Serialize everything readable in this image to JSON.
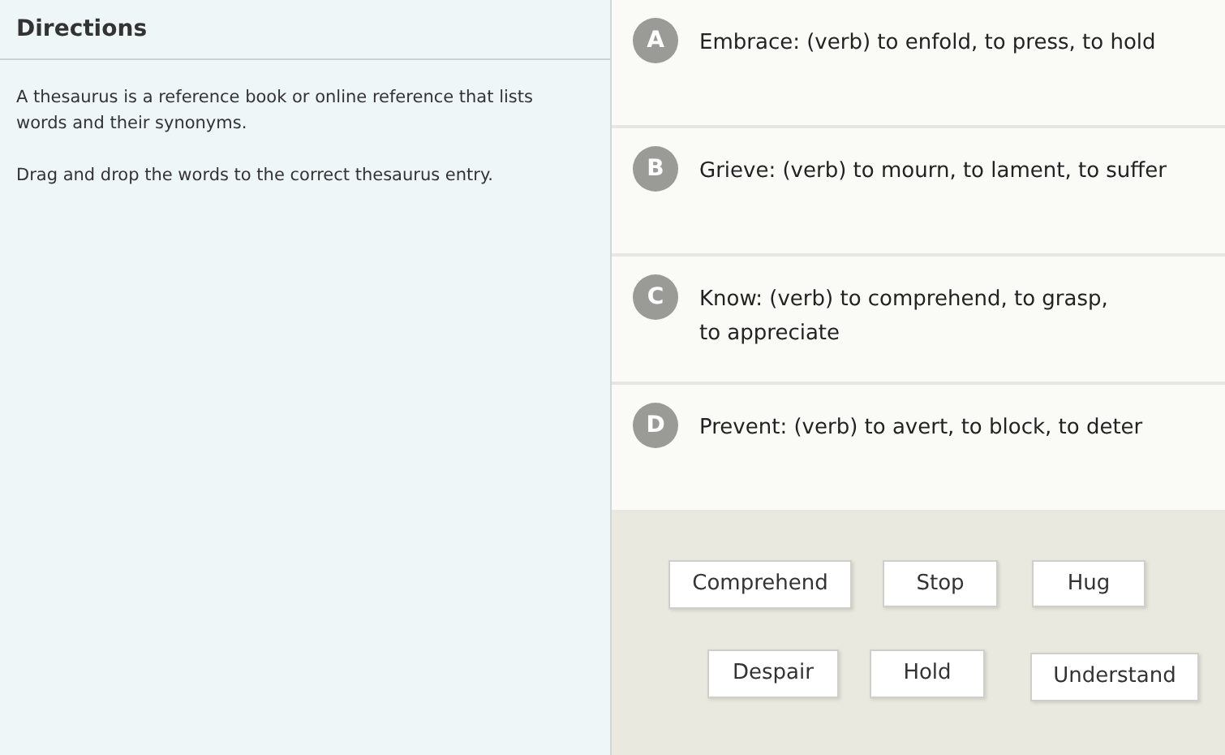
{
  "directions": {
    "title": "Directions",
    "paragraphs": [
      "A thesaurus is a reference book or online reference that lists words and their synonyms.",
      "Drag and drop the words to the correct thesaurus entry."
    ]
  },
  "entries": [
    {
      "letter": "A",
      "lines": [
        "Embrace: (verb) to enfold, to press, to hold"
      ]
    },
    {
      "letter": "B",
      "lines": [
        "Grieve: (verb) to mourn, to lament, to suffer"
      ]
    },
    {
      "letter": "C",
      "lines": [
        "Know: (verb) to comprehend, to grasp,",
        "to appreciate"
      ]
    },
    {
      "letter": "D",
      "lines": [
        "Prevent: (verb) to avert, to block, to deter"
      ]
    }
  ],
  "word_bank": [
    "Comprehend",
    "Stop",
    "Hug",
    "Despair",
    "Hold",
    "Understand"
  ]
}
